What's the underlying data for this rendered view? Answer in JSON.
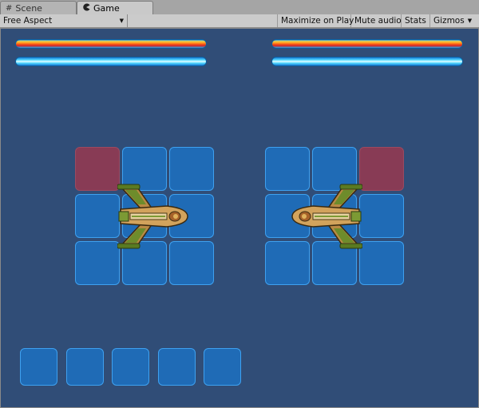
{
  "tabs": [
    {
      "label": "Scene",
      "icon": "grid-icon"
    },
    {
      "label": "Game",
      "icon": "pacman-icon"
    }
  ],
  "toolbar": {
    "aspect": "Free Aspect",
    "maximize": "Maximize on Play",
    "mute": "Mute audio",
    "stats": "Stats",
    "gizmos": "Gizmos"
  },
  "colors": {
    "background": "#304d77",
    "cell": "#1f6bb6",
    "cell_border": "#3ea1f0",
    "danger_cell": "#883b55",
    "health_bar": "#e2231a",
    "shield_bar": "#4fd7ff"
  },
  "players": [
    {
      "side": "left",
      "health_fraction": 1.0,
      "shield_fraction": 1.0,
      "highlighted_cell": "row 1, col 1",
      "ship_facing": "right"
    },
    {
      "side": "right",
      "health_fraction": 1.0,
      "shield_fraction": 1.0,
      "highlighted_cell": "row 1, col 3",
      "ship_facing": "left"
    }
  ],
  "grid": {
    "rows": 3,
    "cols": 3
  },
  "hand_slots": 5
}
